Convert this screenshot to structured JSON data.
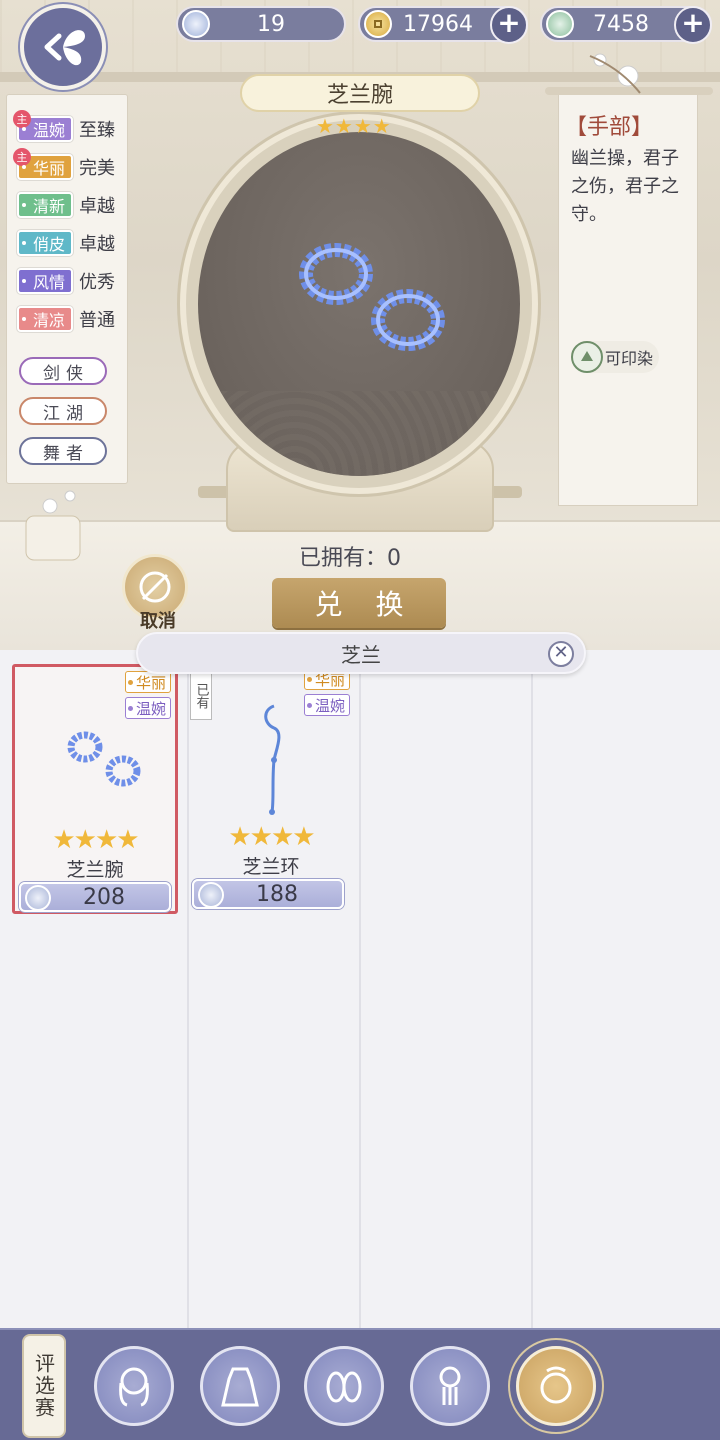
{
  "topbar": {
    "silver": "19",
    "gold": "17964",
    "jade": "7458",
    "plus_label": "+"
  },
  "attributes": [
    {
      "tag": "温婉",
      "level": "至臻",
      "main": true,
      "main_label": "主",
      "color": "#9b7fd3"
    },
    {
      "tag": "华丽",
      "level": "完美",
      "main": true,
      "main_label": "主",
      "color": "#e0a23e"
    },
    {
      "tag": "清新",
      "level": "卓越",
      "main": false,
      "color": "#6fbf8c"
    },
    {
      "tag": "俏皮",
      "level": "卓越",
      "main": false,
      "color": "#5fb8c8"
    },
    {
      "tag": "风情",
      "level": "优秀",
      "main": false,
      "color": "#7f6fd0"
    },
    {
      "tag": "清凉",
      "level": "普通",
      "main": false,
      "color": "#e88a8a"
    }
  ],
  "styles": [
    {
      "label": "剑侠",
      "color": "#9a6ab8"
    },
    {
      "label": "江湖",
      "color": "#c9876a"
    },
    {
      "label": "舞者",
      "color": "#6d7399"
    }
  ],
  "item": {
    "name": "芝兰腕",
    "stars": "★★★★",
    "category": "【手部】",
    "description": "幽兰操，君子之伤，君子之守。",
    "dye_label": "可印染"
  },
  "owned": "已拥有：0",
  "exchange_label": "兑 换",
  "cancel_label": "取消",
  "search": {
    "query": "芝兰",
    "clear_icon": "✕"
  },
  "grid_items": [
    {
      "name": "芝兰腕",
      "stars": "★★★★",
      "price": "208",
      "tags": [
        "华丽",
        "温婉"
      ]
    },
    {
      "name": "芝兰环",
      "stars": "★★★★",
      "price": "188",
      "tags": [
        "华丽",
        "温婉"
      ],
      "owned_flag": "已有"
    }
  ],
  "bottom": {
    "contest_label": "评选赛"
  }
}
